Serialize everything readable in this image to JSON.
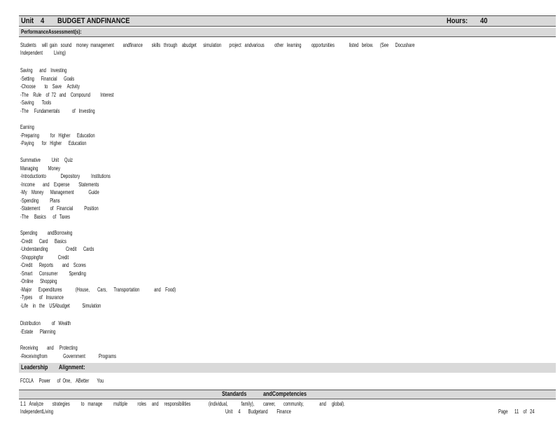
{
  "header": {
    "unit_label": "Unit",
    "unit_number": "4",
    "unit_title": "BUDGET    ANDFINANCE",
    "hours_label": "Hours:",
    "hours_value": "40"
  },
  "performance": {
    "heading": "PerformanceAssessment(s):",
    "intro_line1": "Students     will  gain   sound    money  management        andfinance        skills   through    abudget      simulation       project   andvarious         other   learning         opportunities             listed   below.      (See      Docushare",
    "intro_line2": "Independent          Living)"
  },
  "sections": [
    {
      "lines": [
        "Saving      and    Investing",
        "-Setting      Financial      Goals",
        "-Choose        to    Save     Activity",
        "-The    Rule    of  72   and    Compound         Interest",
        "-Saving       Tools",
        "-The     Fundamentals           of   Investing"
      ]
    },
    {
      "lines": [
        "Earning",
        "-Preparing          for   Higher      Education",
        "-Paying       for   Higher      Education"
      ]
    },
    {
      "lines": [
        "Summative          Unit     Quiz",
        "Managing         Money",
        "-Introductionto             Depository          Institutions",
        "-Income       and    Expense        Statements",
        "-My    Money      Management             Guide",
        "-Spending          Plans",
        "-Statement         of   Financial          Position",
        "-The     Basics      of   Taxes"
      ]
    },
    {
      "lines": [
        "Spending         andBorrowing",
        "-Credit      Card      Basics",
        "-Understanding                Credit      Cards",
        "-Shoppingfor             Credit",
        "-Credit      Reports        and    Scores",
        "-Smart      Consumer          Spending",
        "-Online      Shopping",
        "-Major      Expenditures            (House,       Cars,      Transportation             and    Food)",
        "-Types      of   Insurance",
        "-Life    in   the    USAbudget           Simulation"
      ]
    },
    {
      "lines": [
        "Distribution          of   Wealth",
        "-Estate      Planning"
      ]
    },
    {
      "lines": [
        "Receiving        and     Protecting",
        "-Receivingfrom              Government            Programs"
      ]
    }
  ],
  "leadership": {
    "label": "Leadership",
    "alignment": "Alignment:",
    "text": "FCCLA     Power      of  One,    ABetter       You"
  },
  "standards": {
    "heading_left": "Standards",
    "heading_right": "andCompetencies",
    "item": "1.1   Analyze        strategies          to   manage          multiple         roles     and     responsibilities                (individual,            family),        career,       community,              and     global)."
  },
  "footer": {
    "left": "IndependentLiving",
    "center": "Unit     4       Budgetand        Finance",
    "right": "Page      11    of   24"
  }
}
